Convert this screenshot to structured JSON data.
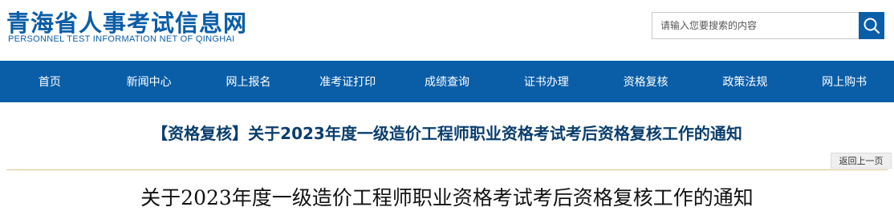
{
  "header": {
    "site_title": "青海省人事考试信息网",
    "site_subtitle": "PERSONNEL TEST INFORMATION NET OF QINGHAI"
  },
  "search": {
    "placeholder": "请输入您要搜索的内容",
    "button_icon": "search-icon"
  },
  "nav": {
    "items": [
      {
        "label": "首页"
      },
      {
        "label": "新闻中心"
      },
      {
        "label": "网上报名"
      },
      {
        "label": "准考证打印"
      },
      {
        "label": "成绩查询"
      },
      {
        "label": "证书办理"
      },
      {
        "label": "资格复核"
      },
      {
        "label": "政策法规"
      },
      {
        "label": "网上购书"
      }
    ]
  },
  "article": {
    "heading": "【资格复核】关于2023年度一级造价工程师职业资格考试考后资格复核工作的通知",
    "back_label": "返回上一页",
    "title": "关于2023年度一级造价工程师职业资格考试考后资格复核工作的通知"
  },
  "colors": {
    "brand_blue": "#0a5ea8",
    "heading_blue": "#0a3e6e",
    "divider_gold": "#d8c48a"
  }
}
